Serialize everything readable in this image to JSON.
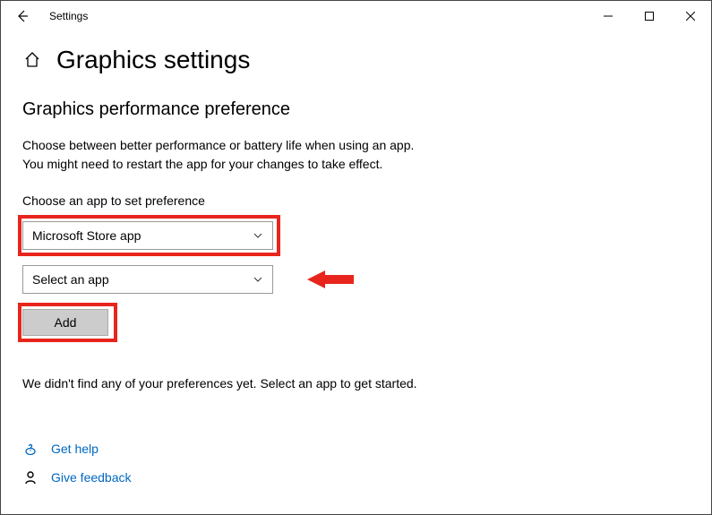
{
  "titlebar": {
    "title": "Settings"
  },
  "page": {
    "title": "Graphics settings"
  },
  "section": {
    "heading": "Graphics performance preference",
    "description_line1": "Choose between better performance or battery life when using an app.",
    "description_line2": "You might need to restart the app for your changes to take effect.",
    "choose_label": "Choose an app to set preference"
  },
  "dropdowns": {
    "app_type": "Microsoft Store app",
    "app_select": "Select an app"
  },
  "buttons": {
    "add": "Add"
  },
  "status": {
    "empty": "We didn't find any of your preferences yet. Select an app to get started."
  },
  "footer": {
    "get_help": "Get help",
    "give_feedback": "Give feedback"
  }
}
